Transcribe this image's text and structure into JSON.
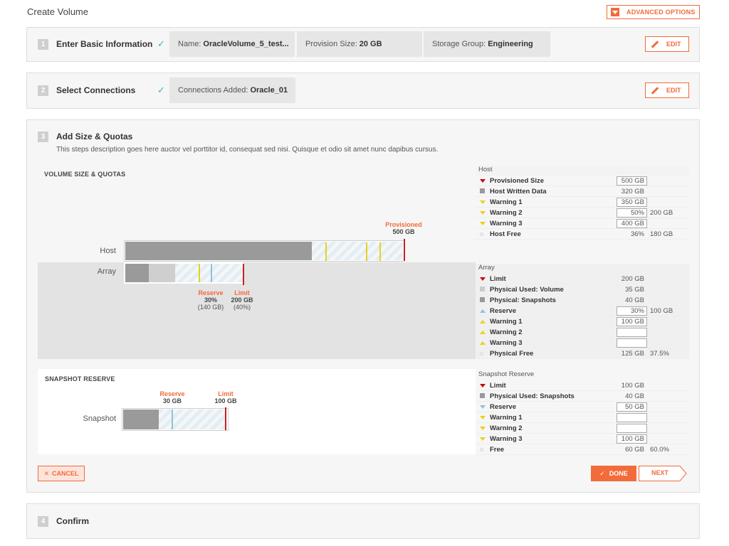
{
  "page": {
    "title": "Create Volume",
    "advanced_label": "ADVANCED OPTIONS"
  },
  "step1": {
    "num": "1",
    "title": "Enter Basic Information",
    "check": "✓",
    "chips": [
      {
        "key": "Name:",
        "value": "OracleVolume_5_test..."
      },
      {
        "key": "Provision Size:",
        "value": "20 GB"
      },
      {
        "key": "Storage Group:",
        "value": "Engineering"
      }
    ],
    "edit_label": "EDIT"
  },
  "step2": {
    "num": "2",
    "title": "Select Connections",
    "check": "✓",
    "chips": [
      {
        "key": "Connections Added:",
        "value": "Oracle_01"
      }
    ],
    "edit_label": "EDIT"
  },
  "step3": {
    "num": "3",
    "title": "Add Size & Quotas",
    "description": "This steps description goes here auctor vel porttitor id, consequat sed nisi. Quisque et odio sit amet nunc dapibus cursus.",
    "volume_section_label": "VOLUME SIZE & QUOTAS",
    "host_label": "Host",
    "array_label": "Array",
    "provisioned": {
      "title": "Provisioned",
      "value": "500 GB"
    },
    "reserve": {
      "title": "Reserve",
      "value": "30%",
      "sub": "(140 GB)"
    },
    "limit": {
      "title": "Limit",
      "value": "200 GB",
      "sub": "(40%)"
    },
    "snapshot_section_label": "SNAPSHOT RESERVE",
    "snapshot_label": "Snapshot",
    "snap_reserve": {
      "title": "Reserve",
      "value": "30 GB"
    },
    "snap_limit": {
      "title": "Limit",
      "value": "100 GB"
    },
    "host_table": {
      "title": "Host",
      "rows": [
        {
          "icon": "tri-down-red",
          "label": "Provisioned Size",
          "box": "500 GB"
        },
        {
          "icon": "square-dark",
          "label": "Host Written Data",
          "value": "320 GB"
        },
        {
          "icon": "tri-down-yellow",
          "label": "Warning 1",
          "box": "350 GB"
        },
        {
          "icon": "tri-down-yellow",
          "label": "Warning 2",
          "box": "50%",
          "extra": "200 GB"
        },
        {
          "icon": "tri-down-yellow",
          "label": "Warning 3",
          "box": "400 GB"
        },
        {
          "icon": "square-faint",
          "label": "Host Free",
          "value": "36%",
          "extra": "180 GB"
        }
      ]
    },
    "array_table": {
      "title": "Array",
      "rows": [
        {
          "icon": "tri-down-red",
          "label": "Limit",
          "value": "200 GB"
        },
        {
          "icon": "square-light",
          "label": "Physical Used: Volume",
          "value": "35 GB"
        },
        {
          "icon": "square-dark",
          "label": "Physical: Snapshots",
          "value": "40 GB"
        },
        {
          "icon": "tri-up-blue",
          "label": "Reserve",
          "box": "30%",
          "extra": "100 GB"
        },
        {
          "icon": "tri-up-yellow",
          "label": "Warning 1",
          "box": "100 GB"
        },
        {
          "icon": "tri-up-yellow",
          "label": "Warning 2",
          "box": ""
        },
        {
          "icon": "tri-up-yellow",
          "label": "Warning 3",
          "box": ""
        },
        {
          "icon": "square-faint",
          "label": "Physical Free",
          "value": "125 GB",
          "extra": "37.5%"
        }
      ]
    },
    "snapshot_table": {
      "title": "Snapshot Reserve",
      "rows": [
        {
          "icon": "tri-down-red",
          "label": "Limit",
          "value": "100 GB"
        },
        {
          "icon": "square-dark",
          "label": "Physical Used: Snapshots",
          "value": "40 GB"
        },
        {
          "icon": "tri-down-blue",
          "label": "Reserve",
          "box": "50 GB"
        },
        {
          "icon": "tri-down-yellow",
          "label": "Warning 1",
          "box": ""
        },
        {
          "icon": "tri-down-yellow",
          "label": "Warning 2",
          "box": ""
        },
        {
          "icon": "tri-down-yellow",
          "label": "Warning 3",
          "box": "100 GB"
        },
        {
          "icon": "square-faint",
          "label": "Free",
          "value": "60 GB",
          "extra": "60.0%"
        }
      ]
    },
    "cancel_label": "CANCEL",
    "done_label": "DONE",
    "next_label": "NEXT"
  },
  "step4": {
    "num": "4",
    "title": "Confirm"
  },
  "colors": {
    "accent": "#f26b3a",
    "check": "#3ab0c8",
    "warning": "#e8d21b",
    "limit": "#cc1f1f",
    "reserve": "#8ec3d6"
  }
}
